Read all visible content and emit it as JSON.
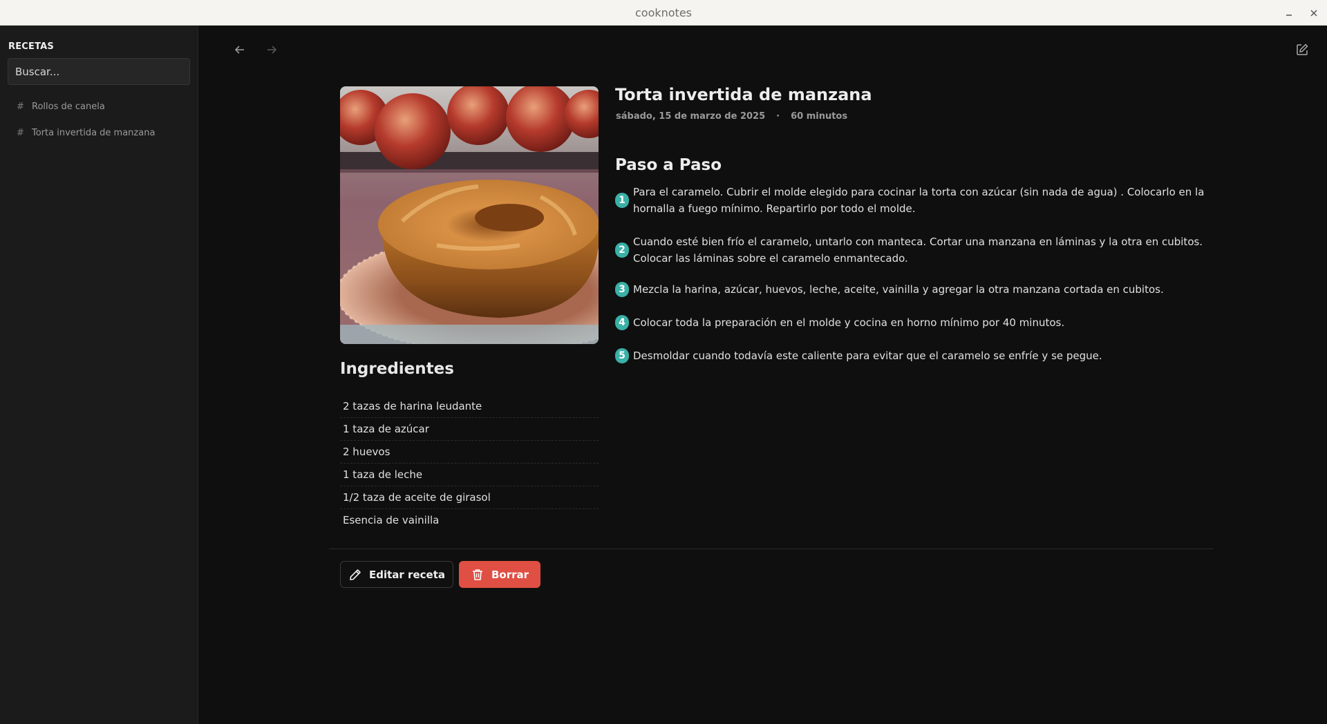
{
  "window": {
    "title": "cooknotes"
  },
  "sidebar": {
    "title": "RECETAS",
    "search_placeholder": "Buscar...",
    "items": [
      {
        "label": "Rollos de canela"
      },
      {
        "label": "Torta invertida de manzana"
      }
    ]
  },
  "recipe": {
    "title": "Torta invertida de manzana",
    "date": "sábado, 15 de marzo de 2025",
    "separator": "·",
    "duration": "60 minutos",
    "ingredients_title": "Ingredientes",
    "ingredients": [
      "2 tazas de harina leudante",
      "1 taza de azúcar",
      "2 huevos",
      "1 taza de leche",
      "1/2 taza de aceite de girasol",
      "Esencia de vainilla"
    ],
    "steps_title": "Paso a Paso",
    "steps": [
      {
        "n": "1",
        "text": "Para el caramelo. Cubrir el molde elegido para cocinar la torta con azúcar (sin nada de agua) . Colocarlo en la hornalla a fuego mínimo. Repartirlo por todo el molde."
      },
      {
        "n": "2",
        "text": "Cuando esté bien frío el caramelo, untarlo con manteca. Cortar una manzana en láminas y la otra en cubitos. Colocar las láminas sobre el caramelo enmantecado."
      },
      {
        "n": "3",
        "text": "Mezcla la harina, azúcar, huevos, leche, aceite, vainilla y agregar la otra manzana cortada en cubitos."
      },
      {
        "n": "4",
        "text": "Colocar toda la preparación en el molde y cocina en horno mínimo por 40 minutos."
      },
      {
        "n": "5",
        "text": "Desmoldar cuando todavía este caliente para evitar que el caramelo se enfríe y se pegue."
      }
    ]
  },
  "actions": {
    "edit_label": "Editar receta",
    "delete_label": "Borrar"
  },
  "colors": {
    "accent": "#3ab0a6",
    "danger": "#e04f43",
    "background": "#0f0f0f",
    "sidebar": "#1b1b1b"
  },
  "icons": {
    "back": "arrow-left-icon",
    "forward": "arrow-right-icon",
    "edit_note": "edit-note-icon",
    "pencil": "pencil-icon",
    "trash": "trash-icon",
    "hash": "hash-icon"
  }
}
